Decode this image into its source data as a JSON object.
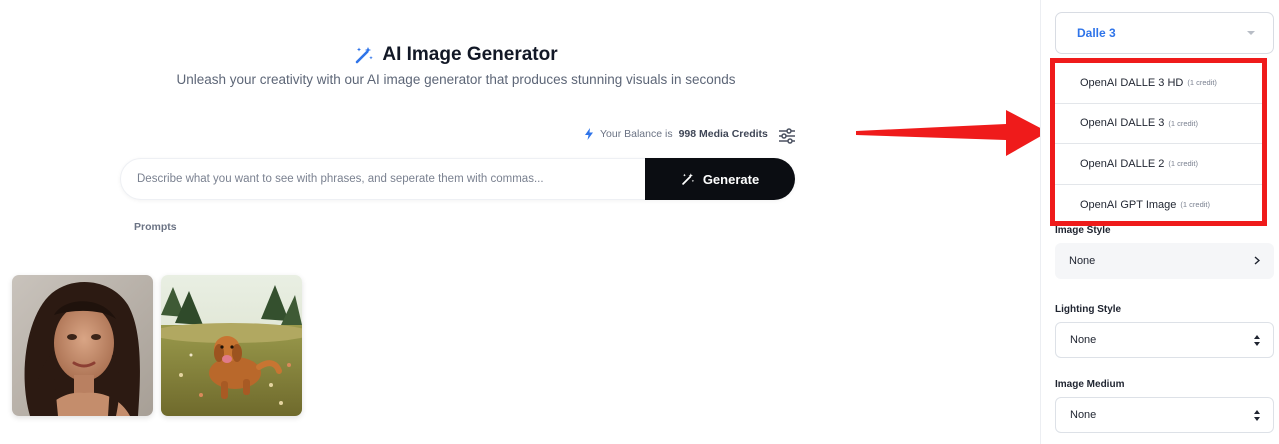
{
  "header": {
    "title": "AI Image Generator",
    "subtitle": "Unleash your creativity with our AI image generator that produces stunning visuals in seconds"
  },
  "balance": {
    "prefix": "Your Balance is",
    "amount": "998 Media Credits"
  },
  "prompt": {
    "placeholder": "Describe what you want to see with phrases, and seperate them with commas...",
    "value": "",
    "generate_label": "Generate"
  },
  "prompts_label": "Prompts",
  "icons": {
    "wand": "magic-wand-icon",
    "bolt": "lightning-bolt-icon",
    "filter": "sliders-icon"
  },
  "sidebar": {
    "model_select": {
      "selected": "Dalle 3"
    },
    "model_options": [
      {
        "label": "OpenAI DALLE 3 HD",
        "credit": "(1 credit)"
      },
      {
        "label": "OpenAI DALLE 3",
        "credit": "(1 credit)"
      },
      {
        "label": "OpenAI DALLE 2",
        "credit": "(1 credit)"
      },
      {
        "label": "OpenAI GPT Image",
        "credit": "(1 credit)"
      }
    ],
    "image_style": {
      "label": "Image Style",
      "value": "None"
    },
    "lighting_style": {
      "label": "Lighting Style",
      "value": "None"
    },
    "image_medium": {
      "label": "Image Medium",
      "value": "None"
    }
  },
  "colors": {
    "accent_blue": "#2f74e9",
    "generate_bg": "#0b0d12",
    "highlight_red": "#ef1b1b"
  }
}
